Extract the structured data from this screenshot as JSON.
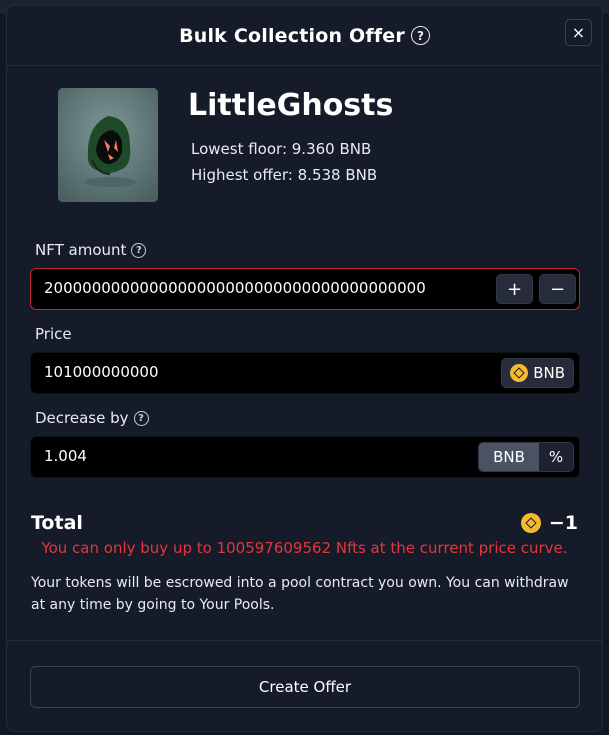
{
  "modal": {
    "title": "Bulk Collection Offer",
    "close_label": "×"
  },
  "collection": {
    "name": "LittleGhosts",
    "lowest_floor": "Lowest floor: 9.360 BNB",
    "highest_offer": "Highest offer: 8.538 BNB"
  },
  "nft_amount": {
    "label": "NFT amount",
    "value": "2000000000000000000000000000000000000000",
    "increment_label": "+",
    "decrement_label": "−"
  },
  "price": {
    "label": "Price",
    "value": "101000000000",
    "currency": "BNB"
  },
  "decrease": {
    "label": "Decrease by",
    "value": "1.004",
    "options": [
      "BNB",
      "%"
    ],
    "selected": "BNB"
  },
  "total": {
    "label": "Total",
    "value": "−1"
  },
  "error_message": "You can only buy up to 100597609562 Nfts at the current price curve.",
  "info_message": "Your tokens will be escrowed into a pool contract you own. You can withdraw at any time by going to Your Pools.",
  "create_button_label": "Create Offer",
  "colors": {
    "accent_bnb": "#f3ba2f",
    "error": "#e5363d",
    "modal_bg": "#151b29"
  }
}
